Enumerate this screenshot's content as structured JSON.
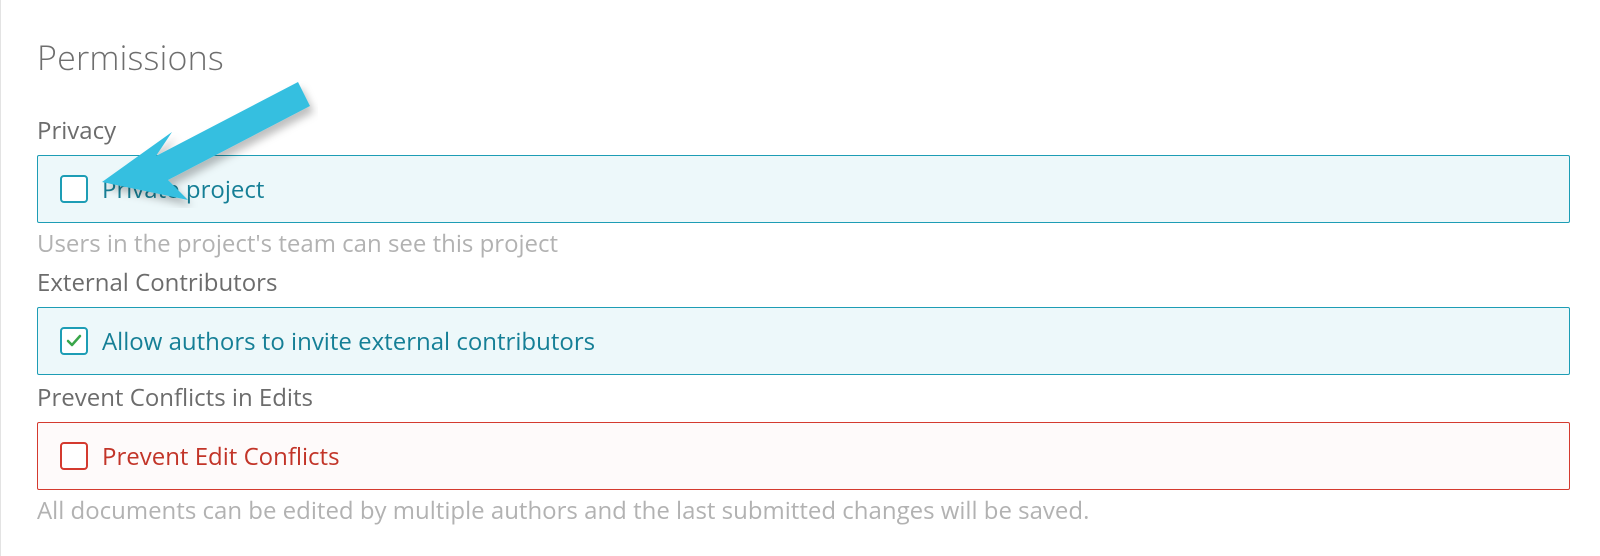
{
  "section_title": "Permissions",
  "privacy": {
    "label": "Privacy",
    "option_label": "Private project",
    "checked": false,
    "helper": "Users in the project's team can see this project"
  },
  "external": {
    "label": "External Contributors",
    "option_label": "Allow authors to invite external contributors",
    "checked": true
  },
  "conflicts": {
    "label": "Prevent Conflicts in Edits",
    "option_label": "Prevent Edit Conflicts",
    "checked": false,
    "helper": "All documents can be edited by multiple authors and the last submitted changes will be saved."
  },
  "colors": {
    "teal": "#1d9db5",
    "red": "#d43a2f",
    "arrow": "#36bfe0"
  }
}
